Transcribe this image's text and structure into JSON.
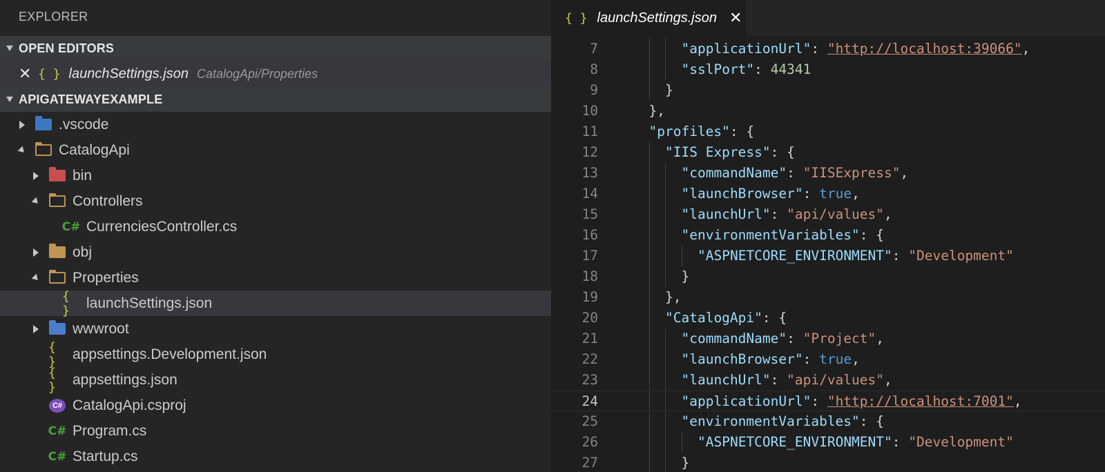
{
  "sidebar": {
    "title": "EXPLORER",
    "open_editors_header": "OPEN EDITORS",
    "open_editor": {
      "close": "✕",
      "icon": "{ }",
      "name": "launchSettings.json",
      "description": "CatalogApi/Properties"
    },
    "project_header": "APIGATEWAYEXAMPLE",
    "tree": [
      {
        "label": ".vscode",
        "indent": 0,
        "twisty": "closed",
        "icon": "folder-vscode-icon"
      },
      {
        "label": "CatalogApi",
        "indent": 0,
        "twisty": "open",
        "icon": "folder-open-icon"
      },
      {
        "label": "bin",
        "indent": 1,
        "twisty": "closed",
        "icon": "folder-bin-icon"
      },
      {
        "label": "Controllers",
        "indent": 1,
        "twisty": "open",
        "icon": "folder-open-icon"
      },
      {
        "label": "CurrenciesController.cs",
        "indent": 2,
        "twisty": "none",
        "icon": "csharp-icon"
      },
      {
        "label": "obj",
        "indent": 1,
        "twisty": "closed",
        "icon": "folder-icon"
      },
      {
        "label": "Properties",
        "indent": 1,
        "twisty": "open",
        "icon": "folder-open-icon"
      },
      {
        "label": "launchSettings.json",
        "indent": 2,
        "twisty": "none",
        "icon": "json-icon",
        "selected": true
      },
      {
        "label": "wwwroot",
        "indent": 1,
        "twisty": "closed",
        "icon": "folder-www-icon"
      },
      {
        "label": "appsettings.Development.json",
        "indent": 1,
        "twisty": "none",
        "icon": "json-icon"
      },
      {
        "label": "appsettings.json",
        "indent": 1,
        "twisty": "none",
        "icon": "json-icon"
      },
      {
        "label": "CatalogApi.csproj",
        "indent": 1,
        "twisty": "none",
        "icon": "csproj-icon"
      },
      {
        "label": "Program.cs",
        "indent": 1,
        "twisty": "none",
        "icon": "csharp-icon"
      },
      {
        "label": "Startup.cs",
        "indent": 1,
        "twisty": "none",
        "icon": "csharp-icon"
      }
    ]
  },
  "editor": {
    "tab": {
      "icon": "{ }",
      "label": "launchSettings.json",
      "close": "✕"
    },
    "current_line": 24,
    "lines": [
      {
        "num": "7",
        "indent": 3,
        "tokens": [
          [
            "k",
            "\"applicationUrl\""
          ],
          [
            "p",
            ": "
          ],
          [
            "u",
            "\"http://localhost:39066\""
          ],
          [
            "p",
            ","
          ]
        ]
      },
      {
        "num": "8",
        "indent": 3,
        "tokens": [
          [
            "k",
            "\"sslPort\""
          ],
          [
            "p",
            ": "
          ],
          [
            "n",
            "44341"
          ]
        ]
      },
      {
        "num": "9",
        "indent": 2,
        "tokens": [
          [
            "p",
            "}"
          ]
        ]
      },
      {
        "num": "10",
        "indent": 1,
        "tokens": [
          [
            "p",
            "},"
          ]
        ]
      },
      {
        "num": "11",
        "indent": 1,
        "tokens": [
          [
            "k",
            "\"profiles\""
          ],
          [
            "p",
            ": {"
          ]
        ]
      },
      {
        "num": "12",
        "indent": 2,
        "tokens": [
          [
            "k",
            "\"IIS Express\""
          ],
          [
            "p",
            ": {"
          ]
        ]
      },
      {
        "num": "13",
        "indent": 3,
        "tokens": [
          [
            "k",
            "\"commandName\""
          ],
          [
            "p",
            ": "
          ],
          [
            "s",
            "\"IISExpress\""
          ],
          [
            "p",
            ","
          ]
        ]
      },
      {
        "num": "14",
        "indent": 3,
        "tokens": [
          [
            "k",
            "\"launchBrowser\""
          ],
          [
            "p",
            ": "
          ],
          [
            "b",
            "true"
          ],
          [
            "p",
            ","
          ]
        ]
      },
      {
        "num": "15",
        "indent": 3,
        "tokens": [
          [
            "k",
            "\"launchUrl\""
          ],
          [
            "p",
            ": "
          ],
          [
            "s",
            "\"api/values\""
          ],
          [
            "p",
            ","
          ]
        ]
      },
      {
        "num": "16",
        "indent": 3,
        "tokens": [
          [
            "k",
            "\"environmentVariables\""
          ],
          [
            "p",
            ": {"
          ]
        ]
      },
      {
        "num": "17",
        "indent": 4,
        "tokens": [
          [
            "k",
            "\"ASPNETCORE_ENVIRONMENT\""
          ],
          [
            "p",
            ": "
          ],
          [
            "s",
            "\"Development\""
          ]
        ]
      },
      {
        "num": "18",
        "indent": 3,
        "tokens": [
          [
            "p",
            "}"
          ]
        ]
      },
      {
        "num": "19",
        "indent": 2,
        "tokens": [
          [
            "p",
            "},"
          ]
        ]
      },
      {
        "num": "20",
        "indent": 2,
        "tokens": [
          [
            "k",
            "\"CatalogApi\""
          ],
          [
            "p",
            ": {"
          ]
        ]
      },
      {
        "num": "21",
        "indent": 3,
        "tokens": [
          [
            "k",
            "\"commandName\""
          ],
          [
            "p",
            ": "
          ],
          [
            "s",
            "\"Project\""
          ],
          [
            "p",
            ","
          ]
        ]
      },
      {
        "num": "22",
        "indent": 3,
        "tokens": [
          [
            "k",
            "\"launchBrowser\""
          ],
          [
            "p",
            ": "
          ],
          [
            "b",
            "true"
          ],
          [
            "p",
            ","
          ]
        ]
      },
      {
        "num": "23",
        "indent": 3,
        "tokens": [
          [
            "k",
            "\"launchUrl\""
          ],
          [
            "p",
            ": "
          ],
          [
            "s",
            "\"api/values\""
          ],
          [
            "p",
            ","
          ]
        ]
      },
      {
        "num": "24",
        "indent": 3,
        "tokens": [
          [
            "k",
            "\"applicationUrl\""
          ],
          [
            "p",
            ": "
          ],
          [
            "u",
            "\"http://localhost:7001\""
          ],
          [
            "p",
            ","
          ]
        ]
      },
      {
        "num": "25",
        "indent": 3,
        "tokens": [
          [
            "k",
            "\"environmentVariables\""
          ],
          [
            "p",
            ": {"
          ]
        ]
      },
      {
        "num": "26",
        "indent": 4,
        "tokens": [
          [
            "k",
            "\"ASPNETCORE_ENVIRONMENT\""
          ],
          [
            "p",
            ": "
          ],
          [
            "s",
            "\"Development\""
          ]
        ]
      },
      {
        "num": "27",
        "indent": 3,
        "tokens": [
          [
            "p",
            "}"
          ]
        ]
      }
    ]
  },
  "colors": {
    "sidebar_bg": "#252526",
    "editor_bg": "#1e1e1e",
    "json_key": "#9cdcfe",
    "json_string": "#ce9178",
    "json_bool": "#569cd6",
    "json_number": "#b5cea8",
    "json_icon": "#cbcb41",
    "csharp_icon": "#4aa13b"
  }
}
